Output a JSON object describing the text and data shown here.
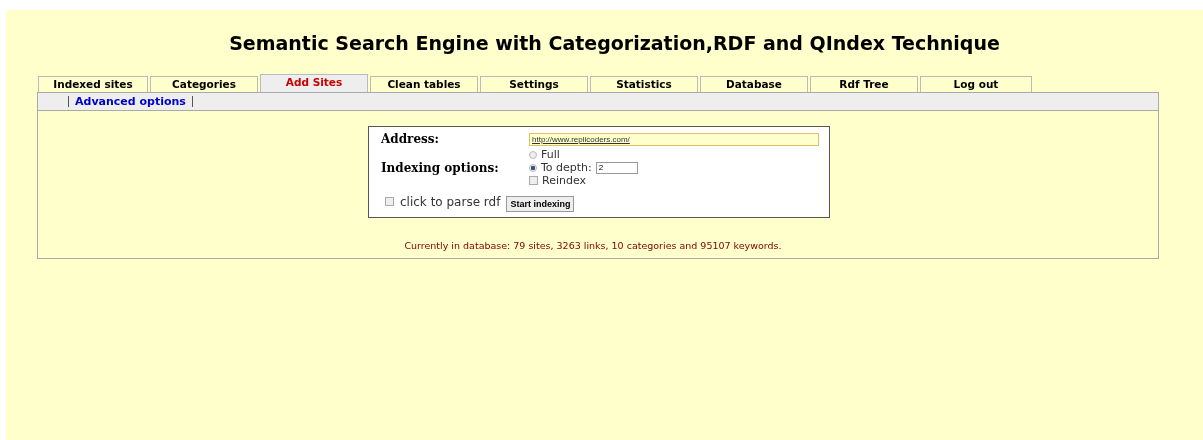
{
  "title": "Semantic Search Engine with Categorization,RDF and QIndex Technique",
  "tabs": [
    {
      "label": "Indexed sites",
      "selected": false
    },
    {
      "label": "Categories",
      "selected": false
    },
    {
      "label": "Add Sites",
      "selected": true
    },
    {
      "label": "Clean tables",
      "selected": false
    },
    {
      "label": "Settings",
      "selected": false
    },
    {
      "label": "Statistics",
      "selected": false
    },
    {
      "label": "Database",
      "selected": false
    },
    {
      "label": "Rdf Tree",
      "selected": false
    },
    {
      "label": "Log out",
      "selected": false
    }
  ],
  "subnav": {
    "link": "Advanced options"
  },
  "form": {
    "address_label": "Address:",
    "address_value": "http://www.replicoders.com/",
    "indexing_label": "Indexing options:",
    "options": [
      {
        "kind": "radio",
        "label": "Full",
        "checked": false
      },
      {
        "kind": "radio",
        "label": "To depth:",
        "checked": true,
        "value": "2"
      },
      {
        "kind": "checkbox",
        "label": "Reindex",
        "checked": false
      }
    ],
    "parse_rdf": {
      "label": "click to parse rdf",
      "checked": false
    },
    "button": "Start indexing"
  },
  "status": "Currently in database: 79 sites, 3263 links, 10 categories and 95107 keywords."
}
